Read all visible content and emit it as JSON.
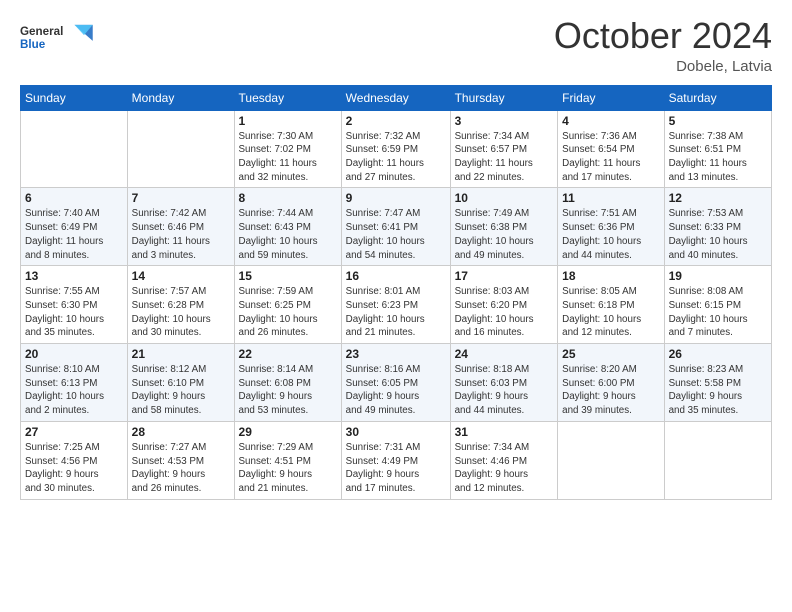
{
  "header": {
    "logo_general": "General",
    "logo_blue": "Blue",
    "month": "October 2024",
    "location": "Dobele, Latvia"
  },
  "weekdays": [
    "Sunday",
    "Monday",
    "Tuesday",
    "Wednesday",
    "Thursday",
    "Friday",
    "Saturday"
  ],
  "weeks": [
    [
      {
        "day": "",
        "info": ""
      },
      {
        "day": "",
        "info": ""
      },
      {
        "day": "1",
        "info": "Sunrise: 7:30 AM\nSunset: 7:02 PM\nDaylight: 11 hours\nand 32 minutes."
      },
      {
        "day": "2",
        "info": "Sunrise: 7:32 AM\nSunset: 6:59 PM\nDaylight: 11 hours\nand 27 minutes."
      },
      {
        "day": "3",
        "info": "Sunrise: 7:34 AM\nSunset: 6:57 PM\nDaylight: 11 hours\nand 22 minutes."
      },
      {
        "day": "4",
        "info": "Sunrise: 7:36 AM\nSunset: 6:54 PM\nDaylight: 11 hours\nand 17 minutes."
      },
      {
        "day": "5",
        "info": "Sunrise: 7:38 AM\nSunset: 6:51 PM\nDaylight: 11 hours\nand 13 minutes."
      }
    ],
    [
      {
        "day": "6",
        "info": "Sunrise: 7:40 AM\nSunset: 6:49 PM\nDaylight: 11 hours\nand 8 minutes."
      },
      {
        "day": "7",
        "info": "Sunrise: 7:42 AM\nSunset: 6:46 PM\nDaylight: 11 hours\nand 3 minutes."
      },
      {
        "day": "8",
        "info": "Sunrise: 7:44 AM\nSunset: 6:43 PM\nDaylight: 10 hours\nand 59 minutes."
      },
      {
        "day": "9",
        "info": "Sunrise: 7:47 AM\nSunset: 6:41 PM\nDaylight: 10 hours\nand 54 minutes."
      },
      {
        "day": "10",
        "info": "Sunrise: 7:49 AM\nSunset: 6:38 PM\nDaylight: 10 hours\nand 49 minutes."
      },
      {
        "day": "11",
        "info": "Sunrise: 7:51 AM\nSunset: 6:36 PM\nDaylight: 10 hours\nand 44 minutes."
      },
      {
        "day": "12",
        "info": "Sunrise: 7:53 AM\nSunset: 6:33 PM\nDaylight: 10 hours\nand 40 minutes."
      }
    ],
    [
      {
        "day": "13",
        "info": "Sunrise: 7:55 AM\nSunset: 6:30 PM\nDaylight: 10 hours\nand 35 minutes."
      },
      {
        "day": "14",
        "info": "Sunrise: 7:57 AM\nSunset: 6:28 PM\nDaylight: 10 hours\nand 30 minutes."
      },
      {
        "day": "15",
        "info": "Sunrise: 7:59 AM\nSunset: 6:25 PM\nDaylight: 10 hours\nand 26 minutes."
      },
      {
        "day": "16",
        "info": "Sunrise: 8:01 AM\nSunset: 6:23 PM\nDaylight: 10 hours\nand 21 minutes."
      },
      {
        "day": "17",
        "info": "Sunrise: 8:03 AM\nSunset: 6:20 PM\nDaylight: 10 hours\nand 16 minutes."
      },
      {
        "day": "18",
        "info": "Sunrise: 8:05 AM\nSunset: 6:18 PM\nDaylight: 10 hours\nand 12 minutes."
      },
      {
        "day": "19",
        "info": "Sunrise: 8:08 AM\nSunset: 6:15 PM\nDaylight: 10 hours\nand 7 minutes."
      }
    ],
    [
      {
        "day": "20",
        "info": "Sunrise: 8:10 AM\nSunset: 6:13 PM\nDaylight: 10 hours\nand 2 minutes."
      },
      {
        "day": "21",
        "info": "Sunrise: 8:12 AM\nSunset: 6:10 PM\nDaylight: 9 hours\nand 58 minutes."
      },
      {
        "day": "22",
        "info": "Sunrise: 8:14 AM\nSunset: 6:08 PM\nDaylight: 9 hours\nand 53 minutes."
      },
      {
        "day": "23",
        "info": "Sunrise: 8:16 AM\nSunset: 6:05 PM\nDaylight: 9 hours\nand 49 minutes."
      },
      {
        "day": "24",
        "info": "Sunrise: 8:18 AM\nSunset: 6:03 PM\nDaylight: 9 hours\nand 44 minutes."
      },
      {
        "day": "25",
        "info": "Sunrise: 8:20 AM\nSunset: 6:00 PM\nDaylight: 9 hours\nand 39 minutes."
      },
      {
        "day": "26",
        "info": "Sunrise: 8:23 AM\nSunset: 5:58 PM\nDaylight: 9 hours\nand 35 minutes."
      }
    ],
    [
      {
        "day": "27",
        "info": "Sunrise: 7:25 AM\nSunset: 4:56 PM\nDaylight: 9 hours\nand 30 minutes."
      },
      {
        "day": "28",
        "info": "Sunrise: 7:27 AM\nSunset: 4:53 PM\nDaylight: 9 hours\nand 26 minutes."
      },
      {
        "day": "29",
        "info": "Sunrise: 7:29 AM\nSunset: 4:51 PM\nDaylight: 9 hours\nand 21 minutes."
      },
      {
        "day": "30",
        "info": "Sunrise: 7:31 AM\nSunset: 4:49 PM\nDaylight: 9 hours\nand 17 minutes."
      },
      {
        "day": "31",
        "info": "Sunrise: 7:34 AM\nSunset: 4:46 PM\nDaylight: 9 hours\nand 12 minutes."
      },
      {
        "day": "",
        "info": ""
      },
      {
        "day": "",
        "info": ""
      }
    ]
  ]
}
